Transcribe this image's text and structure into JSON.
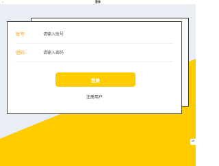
{
  "status_bar": {
    "title": "登录",
    "left_icon": "chevron-icon"
  },
  "form": {
    "account": {
      "label": "账号:",
      "placeholder": "请输入账号",
      "value": ""
    },
    "password": {
      "label": "密码:",
      "placeholder": "请输入密码",
      "value": ""
    },
    "login_label": "登录",
    "register_label": "注册用户"
  },
  "floating_widget": {
    "icon": "side-tool-icon"
  },
  "colors": {
    "accent": "#ffcc00",
    "label": "#f0a020",
    "background": "#e8eef3",
    "button_text": "#ffffff"
  }
}
